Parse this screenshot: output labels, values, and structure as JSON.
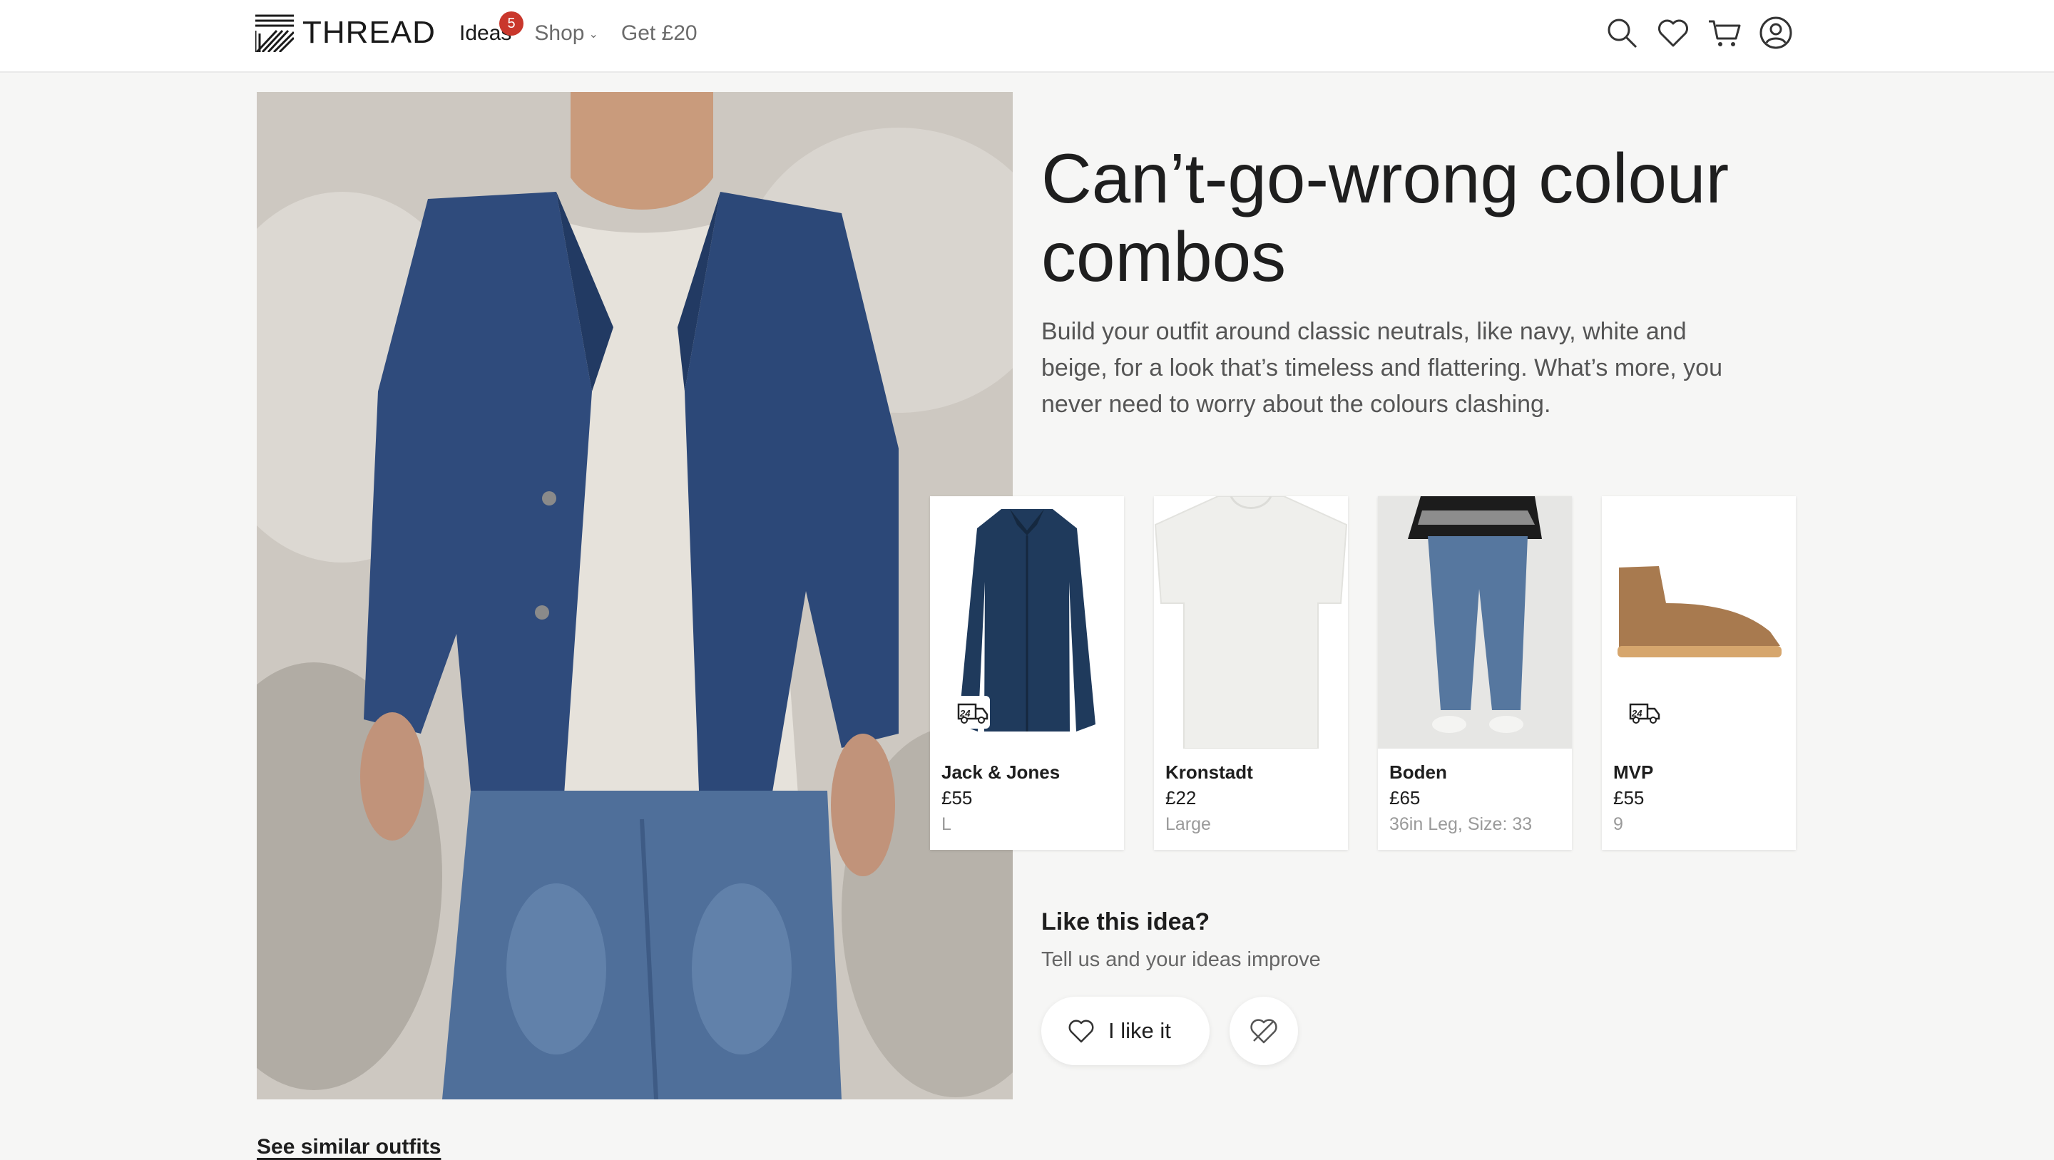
{
  "header": {
    "logo_text": "THREAD",
    "nav": [
      {
        "label": "Ideas",
        "badge": "5"
      },
      {
        "label": "Shop"
      },
      {
        "label": "Get £20"
      }
    ],
    "icons": [
      "search-icon",
      "heart-icon",
      "cart-icon",
      "account-icon"
    ]
  },
  "hero": {
    "title": "Can’t-go-wrong colour combos",
    "description": "Build your outfit around classic neutrals, like navy, white and beige, for a look that’s timeless and flattering. What’s more, you never need to worry about the colours clashing."
  },
  "products": [
    {
      "brand": "Jack & Jones",
      "price": "£55",
      "size": "L",
      "delivery_label": "24",
      "color": "#1f3a5c"
    },
    {
      "brand": "Kronstadt",
      "price": "£22",
      "size": "Large",
      "color": "#efefec"
    },
    {
      "brand": "Boden",
      "price": "£65",
      "size": "36in Leg, Size: 33",
      "color": "#56779f"
    },
    {
      "brand": "MVP",
      "price": "£55",
      "size": "9",
      "delivery_label": "24",
      "color": "#a87a4f"
    }
  ],
  "feedback": {
    "title": "Like this idea?",
    "subtitle": "Tell us and your ideas improve",
    "like_label": "I like it"
  },
  "footer": {
    "similar_link": "See similar outfits"
  },
  "colors": {
    "badge": "#c9372c",
    "background": "#f6f6f5",
    "navy_jacket": "#2e4a7a"
  }
}
